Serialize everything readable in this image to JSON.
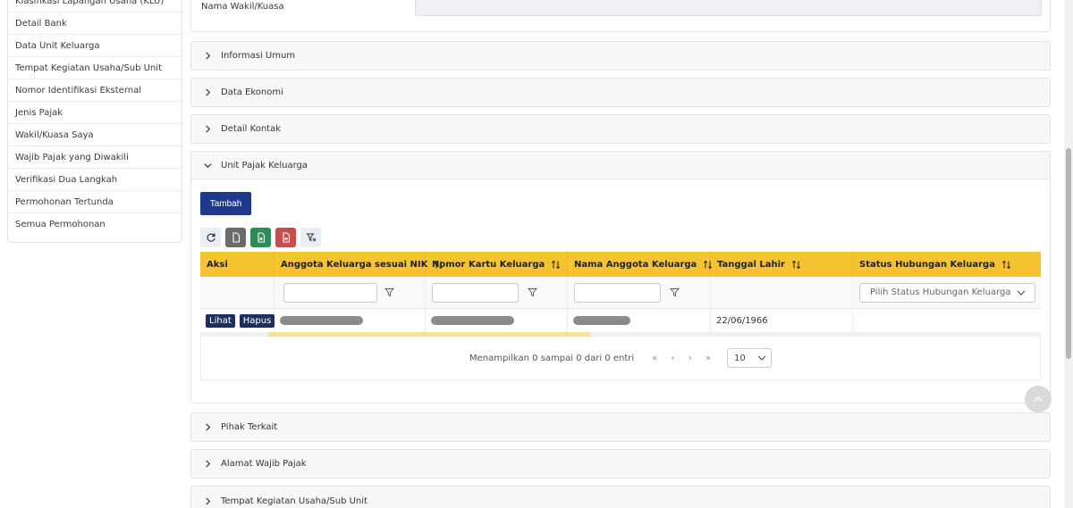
{
  "sidebar": {
    "items": [
      {
        "label": "Klasifikasi Lapangan Usaha (KLU)"
      },
      {
        "label": "Detail Bank"
      },
      {
        "label": "Data Unit Keluarga"
      },
      {
        "label": "Tempat Kegiatan Usaha/Sub Unit"
      },
      {
        "label": "Nomor Identifikasi Eksternal"
      },
      {
        "label": "Jenis Pajak"
      },
      {
        "label": "Wakil/Kuasa Saya"
      },
      {
        "label": "Wajib Pajak yang Diwakili"
      },
      {
        "label": "Verifikasi Dua Langkah"
      },
      {
        "label": "Permohonan Tertunda"
      },
      {
        "label": "Semua Permohonan"
      }
    ]
  },
  "top_field": {
    "label": "Nama Wakil/Kuasa",
    "value": ""
  },
  "sections": {
    "informasi_umum": "Informasi Umum",
    "data_ekonomi": "Data Ekonomi",
    "detail_kontak": "Detail Kontak",
    "unit_pajak_keluarga": "Unit Pajak Keluarga",
    "pihak_terkait": "Pihak Terkait",
    "alamat_wajib_pajak": "Alamat Wajib Pajak",
    "tempat_kegiatan": "Tempat Kegiatan Usaha/Sub Unit"
  },
  "unit_pajak": {
    "add_label": "Tambah",
    "table": {
      "columns": [
        "Aksi",
        "Anggota Keluarga sesuai NIK",
        "Nomor Kartu Keluarga",
        "Nama Anggota Keluarga",
        "Tanggal Lahir",
        "Status Hubungan Keluarga"
      ],
      "status_placeholder": "Pilih Status Hubungan Keluarga",
      "rows": [
        {
          "view_label": "Lihat",
          "delete_label": "Hapus",
          "tanggal_lahir": "22/06/1966"
        }
      ]
    },
    "pagination": {
      "info": "Menampilkan 0 sampai 0 dari 0 entri",
      "first": "«",
      "prev": "‹",
      "next": "›",
      "last": "»",
      "page_size": "10"
    }
  },
  "colors": {
    "primary": "#1e3a8a",
    "header_yellow": "#f4c430"
  }
}
